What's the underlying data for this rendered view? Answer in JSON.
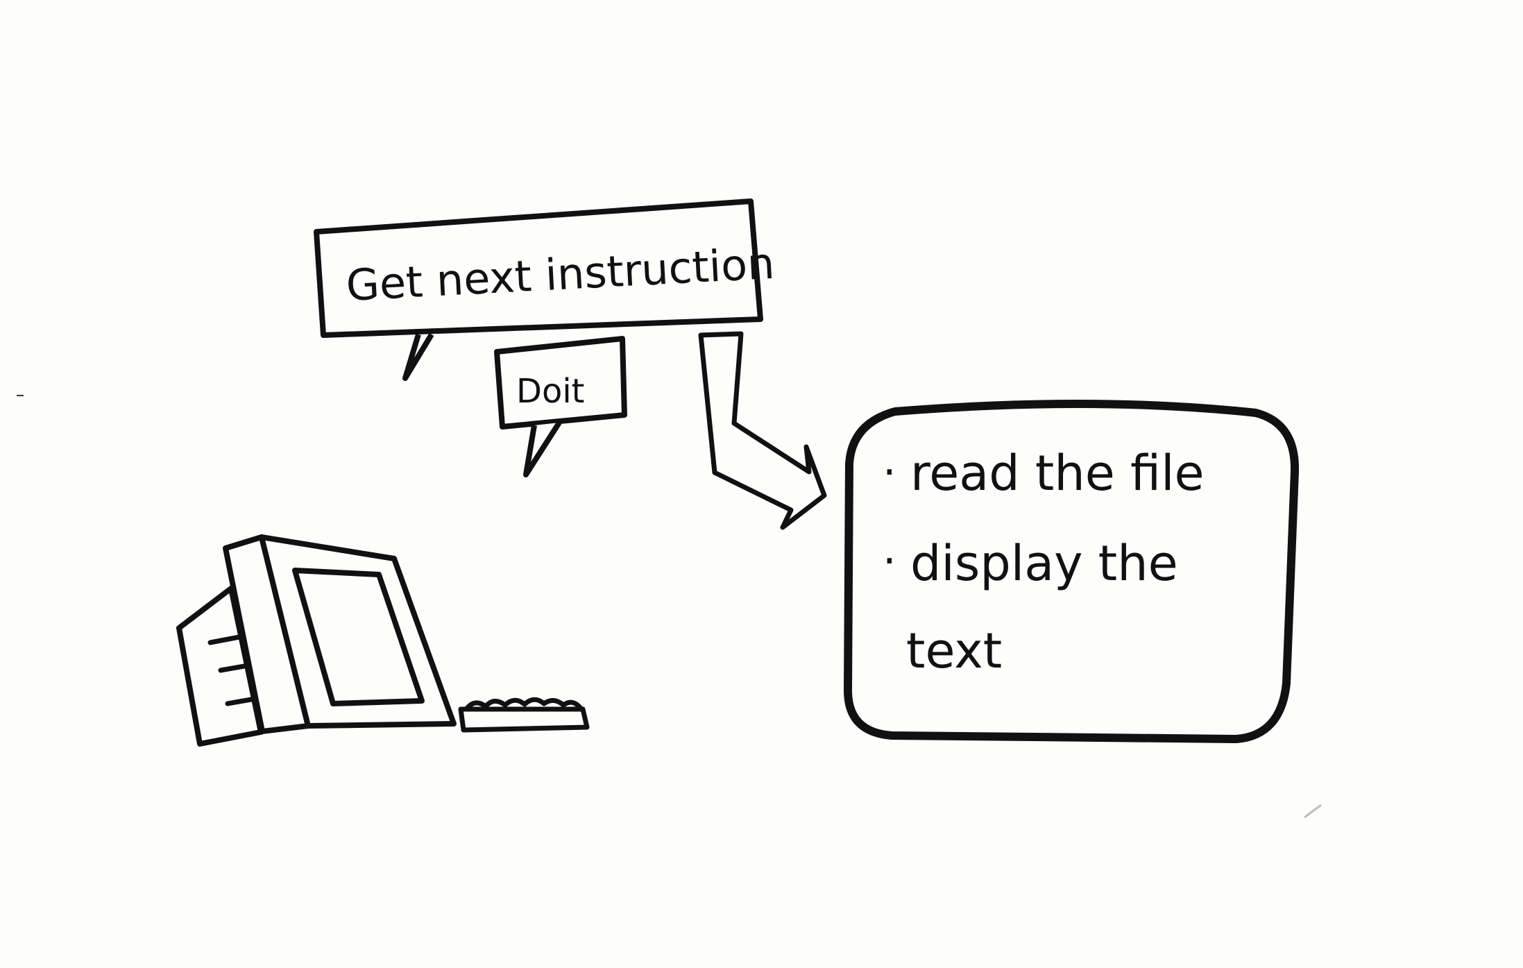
{
  "bubble_main": {
    "text": "Get next instruction"
  },
  "bubble_small": {
    "text": "Doit"
  },
  "instructions": {
    "items": [
      {
        "bullet": "·",
        "lines": [
          "read the file"
        ]
      },
      {
        "bullet": "·",
        "lines": [
          "display the",
          "text"
        ]
      }
    ]
  },
  "colors": {
    "ink": "#111111",
    "paper": "#fdfdfc"
  },
  "icons": {
    "computer": "desktop-computer-icon",
    "keyboard": "keyboard-icon",
    "arrow": "curved-arrow-icon"
  }
}
